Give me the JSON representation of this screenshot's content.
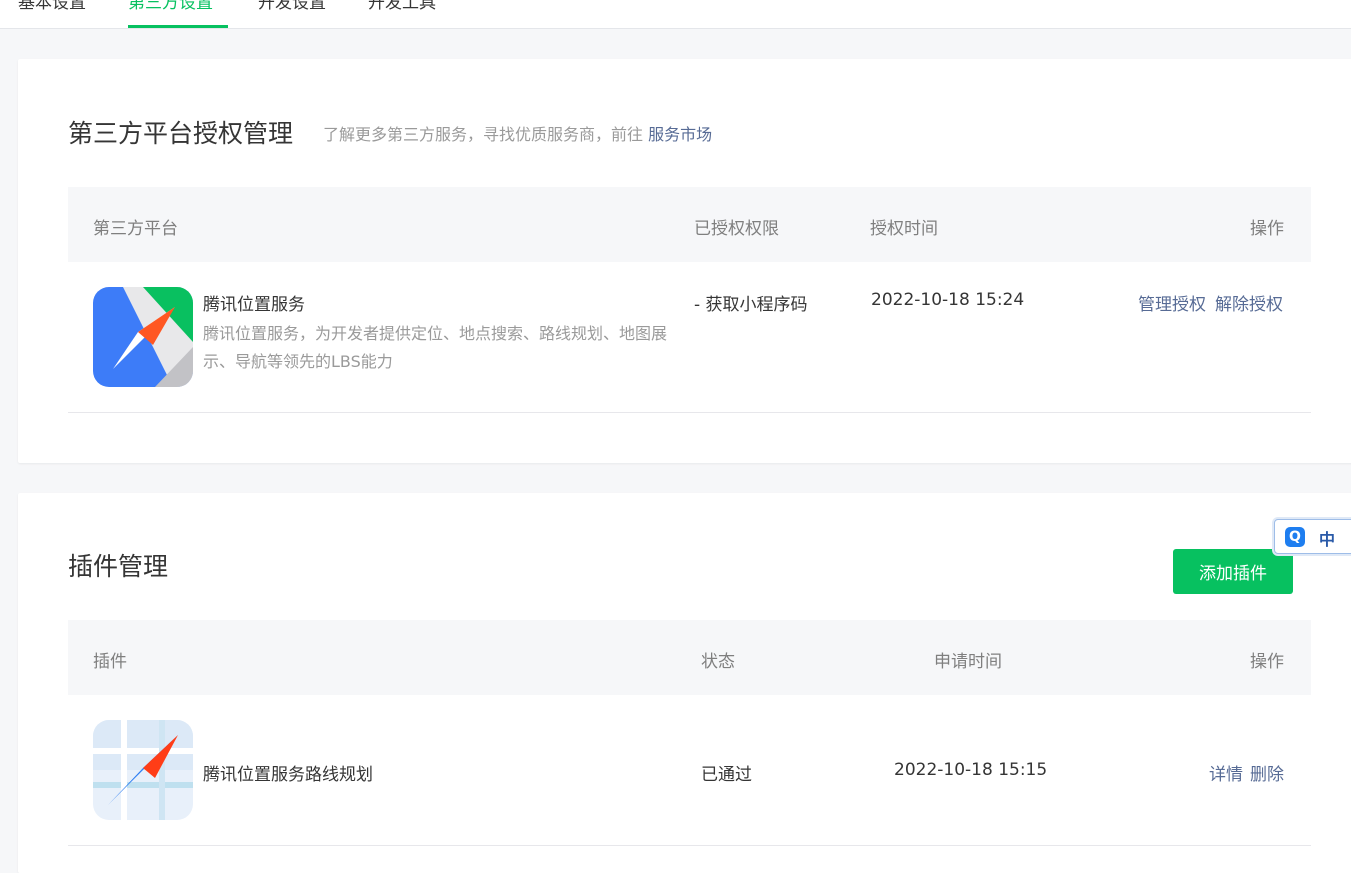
{
  "tabs": [
    {
      "label": "基本设置"
    },
    {
      "label": "第三方设置"
    },
    {
      "label": "开发设置"
    },
    {
      "label": "开发工具"
    }
  ],
  "auth_section": {
    "title": "第三方平台授权管理",
    "subtitle_prefix": "了解更多第三方服务，寻找优质服务商，前往",
    "subtitle_link": "服务市场",
    "columns": {
      "platform": "第三方平台",
      "permission": "已授权权限",
      "time": "授权时间",
      "action": "操作"
    },
    "rows": [
      {
        "name": "腾讯位置服务",
        "description": "腾讯位置服务，为开发者提供定位、地点搜索、路线规划、地图展示、导航等领先的LBS能力",
        "permission": "- 获取小程序码",
        "time": "2022-10-18 15:24",
        "action_manage": "管理授权",
        "action_revoke": "解除授权",
        "icon": "compass-map-icon"
      }
    ]
  },
  "plugin_section": {
    "title": "插件管理",
    "add_button": "添加插件",
    "columns": {
      "plugin": "插件",
      "status": "状态",
      "time": "申请时间",
      "action": "操作"
    },
    "rows": [
      {
        "name": "腾讯位置服务路线规划",
        "status": "已通过",
        "time": "2022-10-18 15:15",
        "action_detail": "详情",
        "action_delete": "删除",
        "icon": "route-plan-icon"
      }
    ]
  },
  "ime": {
    "logo": "Q",
    "mode": "中"
  },
  "colors": {
    "accent": "#07c160",
    "link": "#576b95",
    "muted": "#9a9a9a",
    "header_bg": "#f6f7f9"
  }
}
